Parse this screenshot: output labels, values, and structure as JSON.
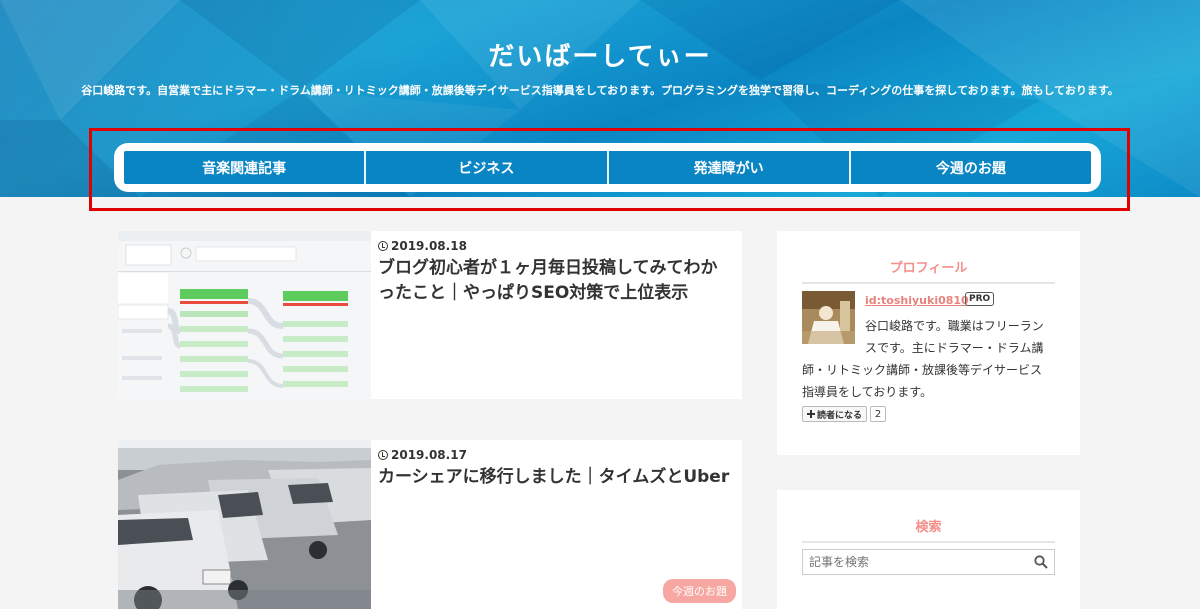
{
  "site": {
    "title": "だいばーしてぃー",
    "description": "谷口峻路です。自営業で主にドラマー・ドラム講師・リトミック講師・放課後等デイサービス指導員をしております。プログラミングを独学で習得し、コーディングの仕事を探しております。旅もしております。"
  },
  "nav": {
    "items": [
      {
        "label": "音楽関連記事"
      },
      {
        "label": "ビジネス"
      },
      {
        "label": "発達障がい"
      },
      {
        "label": "今週のお題"
      }
    ]
  },
  "articles": [
    {
      "date": "2019.08.18",
      "title": "ブログ初心者が１ヶ月毎日投稿してみてわかったこと｜やっぱりSEO対策で上位表示",
      "thumbnail_icon": "analytics-flow-screenshot"
    },
    {
      "date": "2019.08.17",
      "title": "カーシェアに移行しました｜タイムズとUber",
      "category": "今週のお題",
      "thumbnail_icon": "parked-cars-photo"
    }
  ],
  "sidebar": {
    "profile": {
      "heading": "プロフィール",
      "user_id": "id:toshiyuki0810",
      "badge": "PRO",
      "bio_line1": "谷口峻路です。職業はフリーラン",
      "bio_line2": "スです。主にドラマー・ドラム講",
      "bio_rest": "師・リトミック講師・放課後等デイサービス指導員をしております。",
      "follow_label": "読者になる",
      "follower_count": "2"
    },
    "search": {
      "heading": "検索",
      "placeholder": "記事を検索"
    }
  },
  "colors": {
    "nav_bg": "#0a85c4",
    "accent_pink": "#f58f8a",
    "highlight_outline": "#e00000"
  }
}
